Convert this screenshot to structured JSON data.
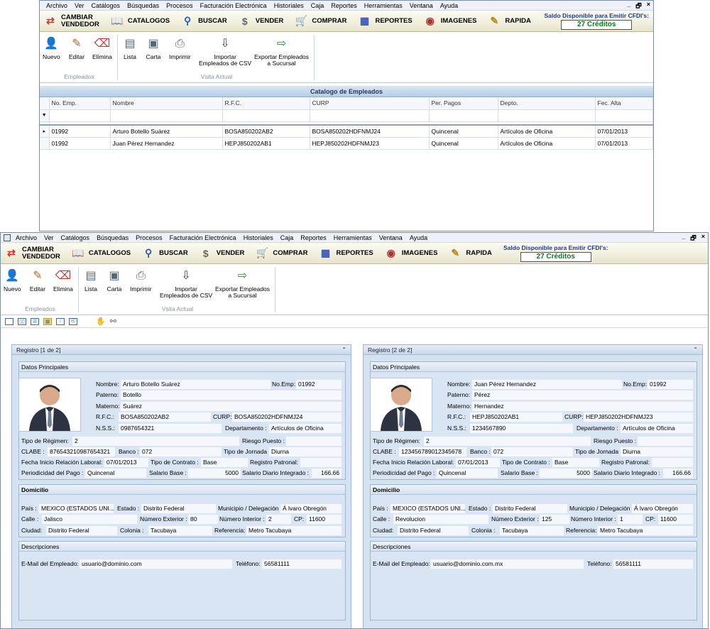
{
  "menu": [
    "Archivo",
    "Ver",
    "Catálogos",
    "Búsquedas",
    "Procesos",
    "Facturación Electrónica",
    "Historiales",
    "Caja",
    "Reportes",
    "Herramientas",
    "Ventana",
    "Ayuda"
  ],
  "window_controls": [
    "_",
    "🗗",
    "×"
  ],
  "toolbar": {
    "buttons": [
      {
        "label1": "CAMBIAR",
        "label2": "VENDEDOR",
        "icon": "swap-arrows-icon"
      },
      {
        "label1": "CATALOGOS",
        "label2": "",
        "icon": "book-icon"
      },
      {
        "label1": "BUSCAR",
        "label2": "",
        "icon": "magnifier-icon"
      },
      {
        "label1": "VENDER",
        "label2": "",
        "icon": "money-bag-icon"
      },
      {
        "label1": "COMPRAR",
        "label2": "",
        "icon": "cart-icon"
      },
      {
        "label1": "REPORTES",
        "label2": "",
        "icon": "report-icon"
      },
      {
        "label1": "IMAGENES",
        "label2": "",
        "icon": "eye-icon"
      },
      {
        "label1": "RAPIDA",
        "label2": "",
        "icon": "quick-icon"
      }
    ],
    "credit_label": "Saldo Disponible para Emitir CFDI's:",
    "credit_value": "27 Créditos"
  },
  "ribbon": {
    "group1": {
      "label": "Empleados",
      "buttons": [
        "Nuevo",
        "Editar",
        "Elimina"
      ]
    },
    "group2": {
      "label": "Vsita Actual",
      "buttons": [
        "Lista",
        "Carta",
        "Imprimir"
      ],
      "import_l1": "Importar",
      "import_l2": "Empleados de CSV",
      "export_l1": "Exportar",
      "export_l2": "a Sucursal",
      "emp_l1": "Empleados",
      "emp_l2": ""
    }
  },
  "grid": {
    "caption": "Catalogo de Empleados",
    "filter_icon": "▼",
    "columns": [
      "No. Emp.",
      "Nombre",
      "R.F.C.",
      "CURP",
      "Per. Pagos",
      "Depto.",
      "Fec. Alta"
    ],
    "rows": [
      [
        "01992",
        "Arturo Botello Suárez",
        "BOSA850202AB2",
        "BOSA850202HDFNMJ24",
        "Quincenal",
        "Artículos de Oficina",
        "07/01/2013"
      ],
      [
        "01992",
        "Juan Pérez Hernandez",
        "HEPJ850202AB1",
        "HEPJ850202HDFNMJ23",
        "Quincenal",
        "Artículos de Oficina",
        "07/01/2013"
      ]
    ]
  },
  "labels": {
    "datos": "Datos Principales",
    "domicilio": "Domicilio",
    "descripciones": "Descripciones",
    "nombre": "Nombre:",
    "noemp": "No.Emp:",
    "paterno": "Paterno:",
    "materno": "Materno:",
    "rfc": "R.F.C.:",
    "curp": "CURP:",
    "nss": "N.S.S.:",
    "depto": "Departamento :",
    "regimen": "Tipo de Régimen:",
    "riesgo": "Riesgo Puesto :",
    "clabe": "CLABE :",
    "banco": "Banco :",
    "jornada": "Tipo de Jornada :",
    "fecha": "Fecha Inicio Relación Laboral:",
    "contrato": "Tipo de Contrato :",
    "patronal": "Registro Patronal:",
    "periodicidad": "Periodicidad del Pago :",
    "salario": "Salario Base :",
    "sdi": "Salario Diario Integrado :",
    "pais": "País :",
    "estado": "Estado :",
    "municipio": "Municipio / Delegación :",
    "calle": "Calle :",
    "numext": "Número Exterior :",
    "numint": "Número Interior :",
    "cp": "CP:",
    "ciudad": "Ciudad:",
    "colonia": "Colonia :",
    "referencia": "Referencia:",
    "email": "E-Mail del Empleado:",
    "telefono": "Teléfono:"
  },
  "cards": [
    {
      "title": "Registro [1 de 2]",
      "nombre": "Arturo Botello Suárez",
      "noemp": "01992",
      "paterno": "Botello",
      "materno": "Suárez",
      "rfc": "BOSA850202AB2",
      "curp": "BOSA850202HDFNMJ24",
      "nss": "0987654321",
      "depto": "Artículos de Oficina",
      "regimen": "2",
      "riesgo": "",
      "clabe": "876543210987654321",
      "banco": "072",
      "jornada": "Diurna",
      "fecha": "07/01/2013",
      "contrato": "Base",
      "patronal": "",
      "periodicidad": "Quincenal",
      "salario": "5000",
      "sdi": "166.66",
      "pais": "MEXICO (ESTADOS UNI...",
      "estado": "Distrito Federal",
      "municipio": "Á  lvaro Obregón",
      "calle": "Jalisco",
      "numext": "80",
      "numint": "2",
      "cp": "11600",
      "ciudad": "Distrito Federal",
      "colonia": "Tacubaya",
      "referencia": "Metro Tacubaya",
      "email": "usuario@dominio.com",
      "telefono": "56581111"
    },
    {
      "title": "Registro [2 de 2]",
      "nombre": "Juan Pérez Hernandez",
      "noemp": "01992",
      "paterno": "Pérez",
      "materno": "Hernandez",
      "rfc": "HEPJ850202AB1",
      "curp": "HEPJ850202HDFNMJ23",
      "nss": "1234567890",
      "depto": "Artículos de Oficina",
      "regimen": "2",
      "riesgo": "",
      "clabe": "123456789012345678",
      "banco": "072",
      "jornada": "Diurna",
      "fecha": "07/01/2013",
      "contrato": "Base",
      "patronal": "",
      "periodicidad": "Quincenal",
      "salario": "5000",
      "sdi": "166.66",
      "pais": "MEXICO (ESTADOS UNI...",
      "estado": "Distrito Federal",
      "municipio": "Á  lvaro Obregón",
      "calle": "Revolucion",
      "numext": "125",
      "numint": "1",
      "cp": "11600",
      "ciudad": "Distrito Federal",
      "colonia": "Tacubaya",
      "referencia": "Metro Tacubaya",
      "email": "usuario@dominio.com.mx",
      "telefono": "56581111"
    }
  ]
}
